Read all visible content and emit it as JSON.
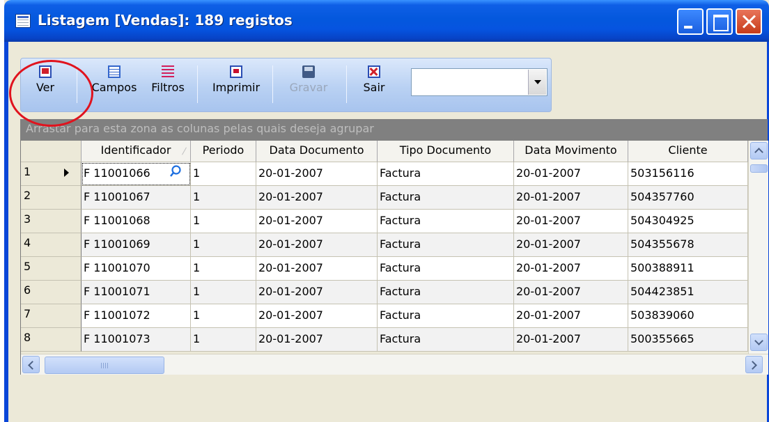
{
  "window": {
    "title": "Listagem [Vendas]: 189 registos",
    "accent_color": "#0a46d8"
  },
  "toolbar": {
    "buttons": [
      {
        "label": "Ver",
        "icon": "view-document-icon",
        "enabled": true
      },
      {
        "label": "Campos",
        "icon": "fields-grid-icon",
        "enabled": true
      },
      {
        "label": "Filtros",
        "icon": "filter-icon",
        "enabled": true
      },
      {
        "label": "Imprimir",
        "icon": "printer-icon",
        "enabled": true
      },
      {
        "label": "Gravar",
        "icon": "floppy-save-icon",
        "enabled": false
      },
      {
        "label": "Sair",
        "icon": "exit-icon",
        "enabled": true
      }
    ],
    "combo_value": ""
  },
  "group_panel": {
    "hint": "Arrastar para esta zona as colunas pelas quais deseja agrupar"
  },
  "grid": {
    "columns": [
      "Identificador",
      "Periodo",
      "Data Documento",
      "Tipo Documento",
      "Data Movimento",
      "Cliente"
    ],
    "sorted_column": "Identificador",
    "current_row": 1,
    "rows": [
      {
        "num": "1",
        "cells": [
          "F 11001066",
          "1",
          "20-01-2007",
          "Factura",
          "20-01-2007",
          "503156116"
        ]
      },
      {
        "num": "2",
        "cells": [
          "F 11001067",
          "1",
          "20-01-2007",
          "Factura",
          "20-01-2007",
          "504357760"
        ]
      },
      {
        "num": "3",
        "cells": [
          "F 11001068",
          "1",
          "20-01-2007",
          "Factura",
          "20-01-2007",
          "504304925"
        ]
      },
      {
        "num": "4",
        "cells": [
          "F 11001069",
          "1",
          "20-01-2007",
          "Factura",
          "20-01-2007",
          "504355678"
        ]
      },
      {
        "num": "5",
        "cells": [
          "F 11001070",
          "1",
          "20-01-2007",
          "Factura",
          "20-01-2007",
          "500388911"
        ]
      },
      {
        "num": "6",
        "cells": [
          "F 11001071",
          "1",
          "20-01-2007",
          "Factura",
          "20-01-2007",
          "504423851"
        ]
      },
      {
        "num": "7",
        "cells": [
          "F 11001072",
          "1",
          "20-01-2007",
          "Factura",
          "20-01-2007",
          "503839060"
        ]
      },
      {
        "num": "8",
        "cells": [
          "F 11001073",
          "1",
          "20-01-2007",
          "Factura",
          "20-01-2007",
          "500355665"
        ]
      }
    ]
  }
}
